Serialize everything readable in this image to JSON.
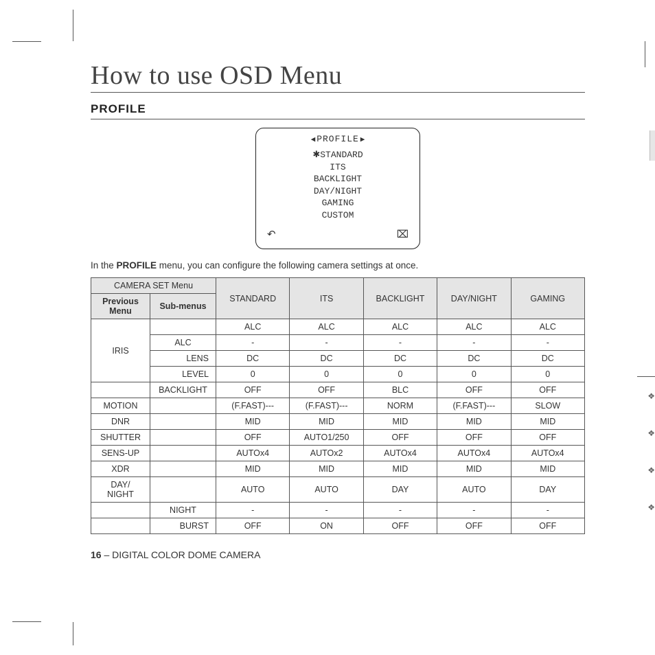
{
  "page": {
    "title": "How to use OSD Menu",
    "section": "PROFILE",
    "pageNumber": "16",
    "productLine": "DIGITAL COLOR DOME CAMERA"
  },
  "osd": {
    "navLeft": "◀",
    "navRight": "▶",
    "title": "PROFILE",
    "star": "✱",
    "items": [
      "STANDARD",
      "ITS",
      "BACKLIGHT",
      "DAY/NIGHT",
      "GAMING",
      "CUSTOM"
    ],
    "backIcon": "↶",
    "closeIcon": "⌧"
  },
  "intro": {
    "pre": "In the ",
    "bold": "PROFILE",
    "post": " menu, you can configure the following camera settings at once."
  },
  "table": {
    "head": {
      "group": "CAMERA SET Menu",
      "prev": "Previous Menu",
      "sub": "Sub-menus",
      "cols": [
        "STANDARD",
        "ITS",
        "BACKLIGHT",
        "DAY/NIGHT",
        "GAMING"
      ]
    },
    "rows": [
      {
        "prev": "IRIS",
        "sub": "",
        "vals": [
          "ALC",
          "ALC",
          "ALC",
          "ALC",
          "ALC"
        ],
        "prevRowspan": 4,
        "subAlign": "center"
      },
      {
        "prev": null,
        "sub": "ALC",
        "vals": [
          "-",
          "-",
          "-",
          "-",
          "-"
        ],
        "subAlign": "center"
      },
      {
        "prev": null,
        "sub": "LENS",
        "vals": [
          "DC",
          "DC",
          "DC",
          "DC",
          "DC"
        ],
        "subAlign": "right"
      },
      {
        "prev": null,
        "sub": "LEVEL",
        "vals": [
          "0",
          "0",
          "0",
          "0",
          "0"
        ],
        "subAlign": "right"
      },
      {
        "prev": "",
        "sub": "BACKLIGHT",
        "vals": [
          "OFF",
          "OFF",
          "BLC",
          "OFF",
          "OFF"
        ],
        "subAlign": "center"
      },
      {
        "prev": "MOTION",
        "sub": "",
        "vals": [
          "(F.FAST)---",
          "(F.FAST)---",
          "NORM",
          "(F.FAST)---",
          "SLOW"
        ]
      },
      {
        "prev": "DNR",
        "sub": "",
        "vals": [
          "MID",
          "MID",
          "MID",
          "MID",
          "MID"
        ]
      },
      {
        "prev": "SHUTTER",
        "sub": "",
        "vals": [
          "OFF",
          "AUTO1/250",
          "OFF",
          "OFF",
          "OFF"
        ]
      },
      {
        "prev": "SENS-UP",
        "sub": "",
        "vals": [
          "AUTOx4",
          "AUTOx2",
          "AUTOx4",
          "AUTOx4",
          "AUTOx4"
        ]
      },
      {
        "prev": "XDR",
        "sub": "",
        "vals": [
          "MID",
          "MID",
          "MID",
          "MID",
          "MID"
        ]
      },
      {
        "prev": "DAY/\nNIGHT",
        "sub": "",
        "vals": [
          "AUTO",
          "AUTO",
          "DAY",
          "AUTO",
          "DAY"
        ]
      },
      {
        "prev": "",
        "sub": "NIGHT",
        "vals": [
          "-",
          "-",
          "-",
          "-",
          "-"
        ],
        "subAlign": "center"
      },
      {
        "prev": "",
        "sub": "BURST",
        "vals": [
          "OFF",
          "ON",
          "OFF",
          "OFF",
          "OFF"
        ],
        "subAlign": "right"
      }
    ]
  },
  "sideBullets": [
    "❖",
    "❖",
    "❖",
    "❖"
  ]
}
